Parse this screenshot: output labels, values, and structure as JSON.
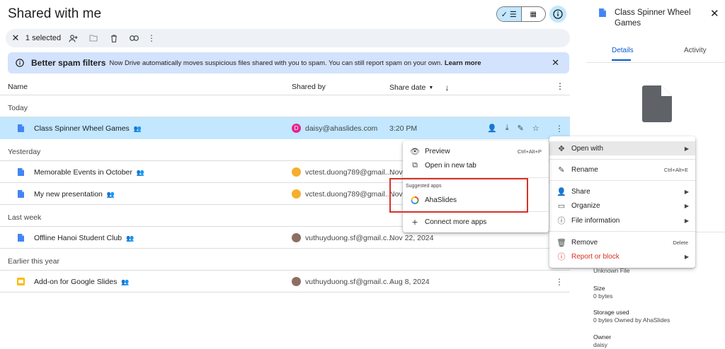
{
  "header": {
    "title": "Shared with me"
  },
  "selection_bar": {
    "count_label": "1 selected"
  },
  "banner": {
    "title": "Better spam filters",
    "text": "Now Drive automatically moves suspicious files shared with you to spam. You can still report spam on your own.",
    "link": "Learn more"
  },
  "columns": {
    "name": "Name",
    "shared_by": "Shared by",
    "share_date": "Share date"
  },
  "sections": {
    "today": "Today",
    "yesterday": "Yesterday",
    "last_week": "Last week",
    "earlier": "Earlier this year"
  },
  "files": [
    {
      "name": "Class Spinner Wheel Games",
      "owner": "daisy@ahaslides.com",
      "date": "3:20 PM",
      "avatar_letter": "D",
      "avatar_color": "#e52592",
      "icon_color": "#4285f4"
    },
    {
      "name": "Memorable Events in October",
      "owner": "vctest.duong789@gmail....",
      "date": "Nov",
      "icon_color": "#4285f4"
    },
    {
      "name": "My new presentation",
      "owner": "vctest.duong789@gmail....",
      "date": "Nov",
      "icon_color": "#4285f4"
    },
    {
      "name": "Offline Hanoi Student Club",
      "owner": "vuthuyduong.sf@gmail.c...",
      "date": "Nov 22, 2024",
      "icon_color": "#4285f4"
    },
    {
      "name": "Add-on for Google Slides",
      "owner": "vuthuyduong.sf@gmail.c...",
      "date": "Aug 8, 2024",
      "icon_color": "#fbbc04"
    }
  ],
  "details_panel": {
    "title": "Class Spinner Wheel Games",
    "tab_details": "Details",
    "tab_activity": "Activity",
    "type_value": "Unknown File",
    "size_label": "Size",
    "size_value": "0 bytes",
    "storage_label": "Storage used",
    "storage_value": "0 bytes Owned by AhaSlides",
    "owner_label": "Owner",
    "owner_value": "daisy"
  },
  "context_menu": {
    "open_with": "Open with",
    "rename": "Rename",
    "rename_shortcut": "Ctrl+Alt+E",
    "share": "Share",
    "organize": "Organize",
    "file_info": "File information",
    "remove": "Remove",
    "remove_shortcut": "Delete",
    "report": "Report or block"
  },
  "submenu": {
    "preview": "Preview",
    "preview_shortcut": "Ctrl+Alt+P",
    "open_new_tab": "Open in new tab",
    "suggested": "Suggested apps",
    "ahaslides": "AhaSlides",
    "connect": "Connect more apps"
  },
  "colors": {
    "accent": "#0b57d0",
    "selected_row": "#c2e7ff",
    "banner_bg": "#d3e3fd",
    "danger": "#d93025"
  }
}
